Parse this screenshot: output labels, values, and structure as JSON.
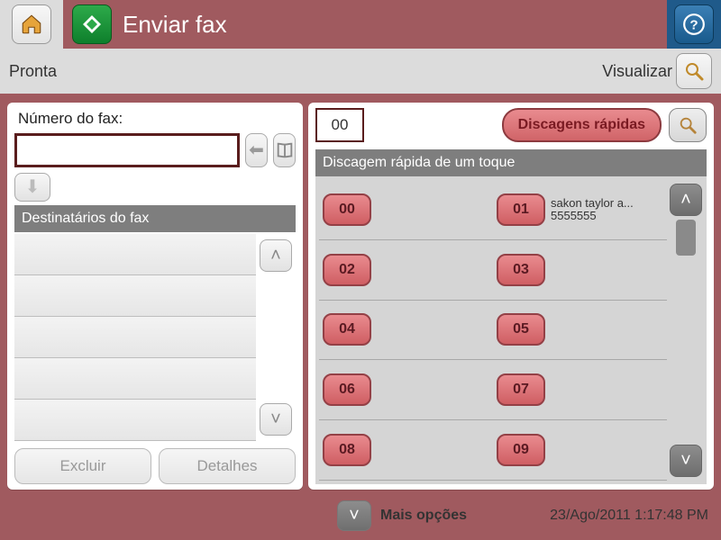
{
  "header": {
    "title": "Enviar fax"
  },
  "status": {
    "ready": "Pronta",
    "preview": "Visualizar"
  },
  "left": {
    "fax_number_label": "Número do fax:",
    "fax_number_value": "",
    "recipients_header": "Destinatários do fax",
    "delete_label": "Excluir",
    "details_label": "Detalhes"
  },
  "right": {
    "code_value": "00",
    "speed_dials_btn": "Discagens rápidas",
    "one_touch_header": "Discagem rápida de um toque",
    "entries": [
      {
        "num": "00",
        "name": "",
        "phone": ""
      },
      {
        "num": "01",
        "name": "sakon taylor a...",
        "phone": "5555555"
      },
      {
        "num": "02",
        "name": "",
        "phone": ""
      },
      {
        "num": "03",
        "name": "",
        "phone": ""
      },
      {
        "num": "04",
        "name": "",
        "phone": ""
      },
      {
        "num": "05",
        "name": "",
        "phone": ""
      },
      {
        "num": "06",
        "name": "",
        "phone": ""
      },
      {
        "num": "07",
        "name": "",
        "phone": ""
      },
      {
        "num": "08",
        "name": "",
        "phone": ""
      },
      {
        "num": "09",
        "name": "",
        "phone": ""
      }
    ]
  },
  "footer": {
    "more_label": "Mais opções",
    "timestamp": "23/Ago/2011 1:17:48 PM"
  },
  "colors": {
    "brand_bg": "#a05a5f",
    "header_blue": "#1f5a8a",
    "accent_red": "#cf5e63"
  }
}
